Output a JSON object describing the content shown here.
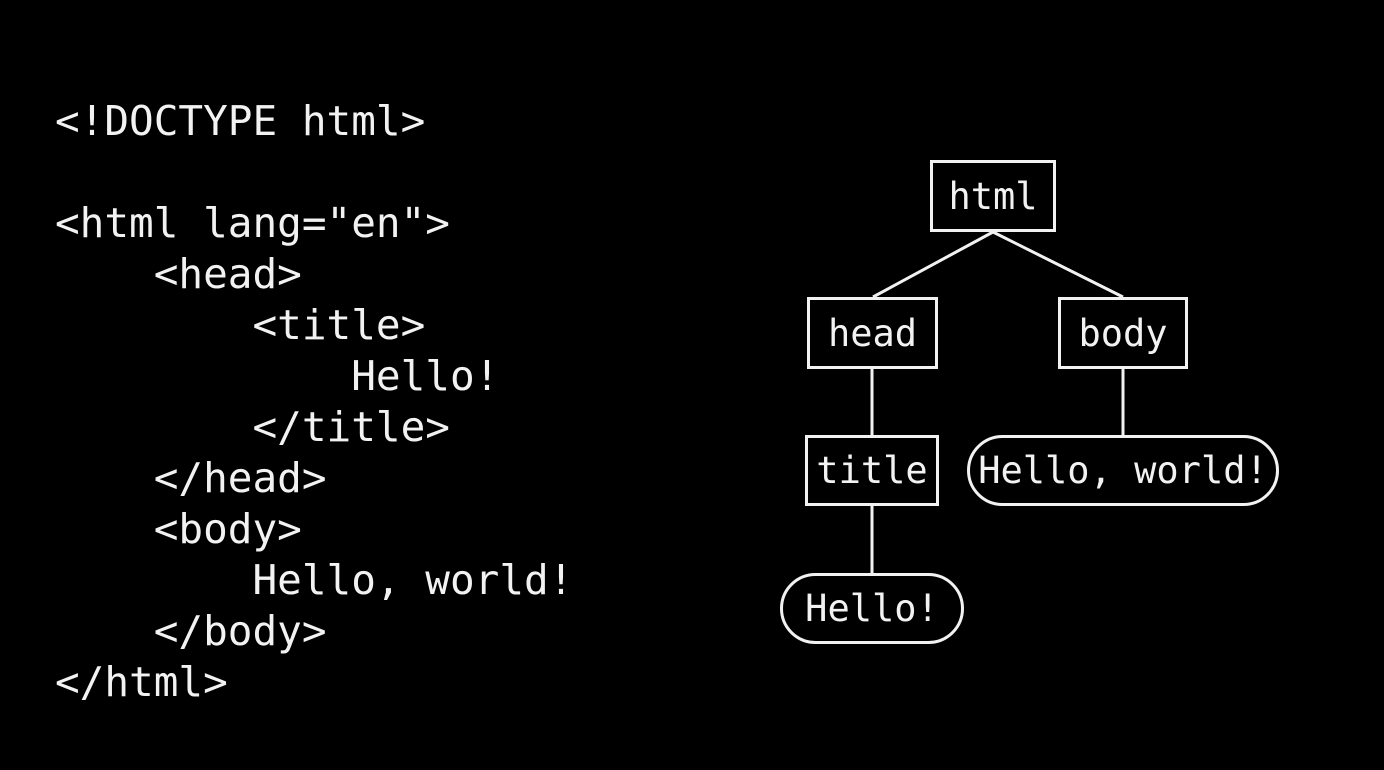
{
  "slide": {
    "background_color": "#000000",
    "foreground_color": "#f2f2f2"
  },
  "code": {
    "language": "html",
    "lines": [
      "<!DOCTYPE html>",
      "",
      "<html lang=\"en\">",
      "    <head>",
      "        <title>",
      "            Hello!",
      "        </title>",
      "    </head>",
      "    <body>",
      "        Hello, world!",
      "    </body>",
      "</html>"
    ]
  },
  "tree": {
    "nodes": [
      {
        "id": "html",
        "label": "html",
        "kind": "element"
      },
      {
        "id": "head",
        "label": "head",
        "kind": "element"
      },
      {
        "id": "body",
        "label": "body",
        "kind": "element"
      },
      {
        "id": "title",
        "label": "title",
        "kind": "element"
      },
      {
        "id": "hello_world",
        "label": "Hello, world!",
        "kind": "text"
      },
      {
        "id": "hello",
        "label": "Hello!",
        "kind": "text"
      }
    ],
    "edges": [
      {
        "from": "html",
        "to": "head"
      },
      {
        "from": "html",
        "to": "body"
      },
      {
        "from": "head",
        "to": "title"
      },
      {
        "from": "body",
        "to": "hello_world"
      },
      {
        "from": "title",
        "to": "hello"
      }
    ]
  }
}
